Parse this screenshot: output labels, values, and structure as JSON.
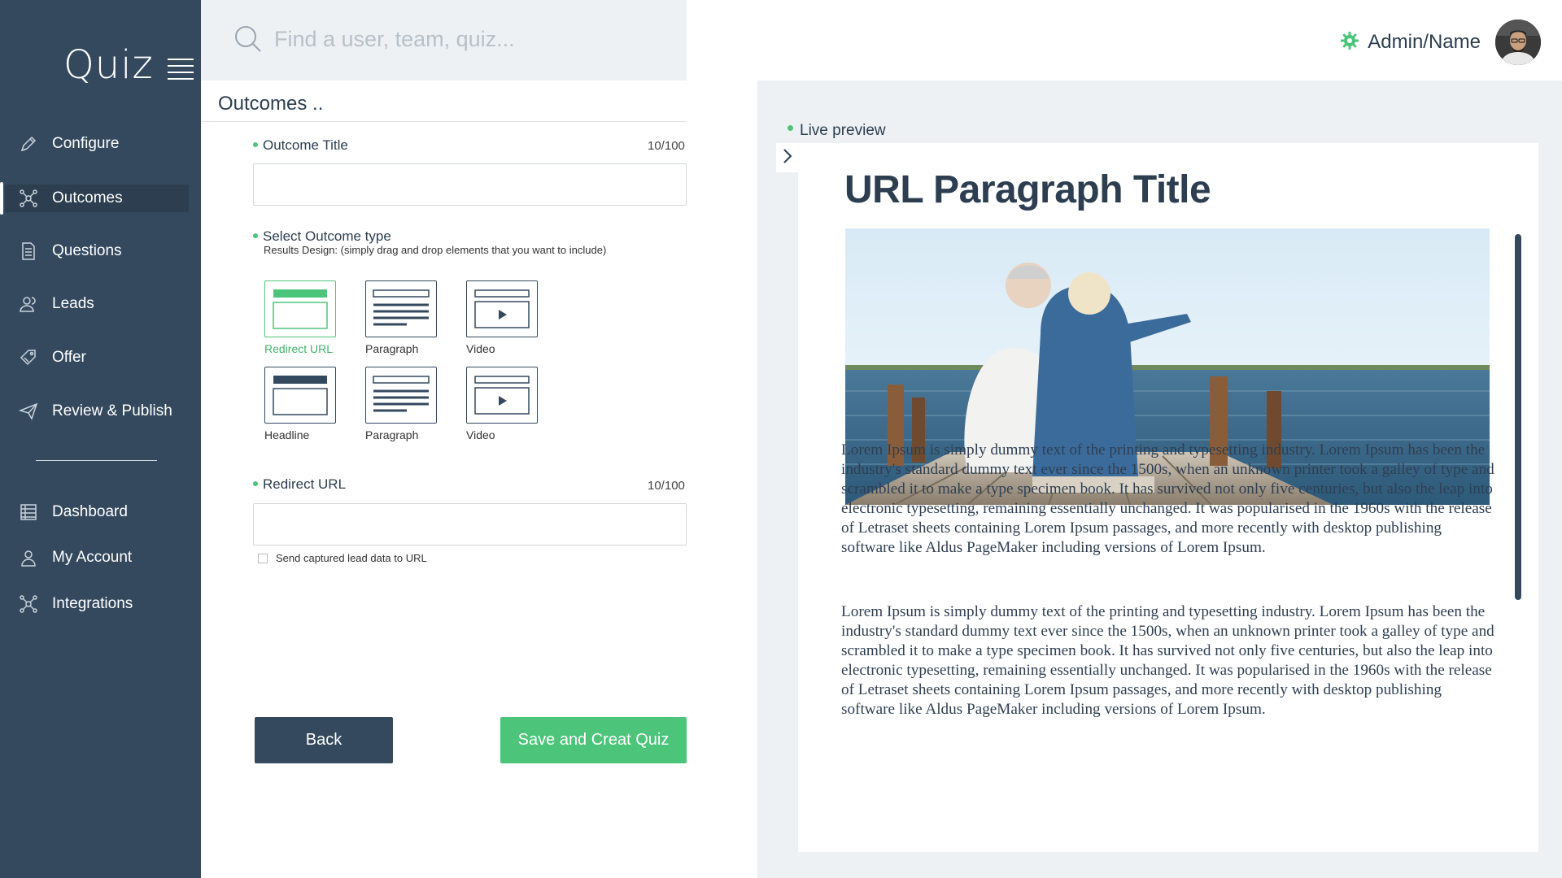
{
  "app": {
    "logo": "Quiz"
  },
  "search": {
    "placeholder": "Find a user, team, quiz..."
  },
  "header": {
    "admin_name": "Admin/Name"
  },
  "sidebar": {
    "items": [
      {
        "label": "Configure",
        "icon": "pencil-icon"
      },
      {
        "label": "Outcomes",
        "icon": "network-icon",
        "active": true
      },
      {
        "label": "Questions",
        "icon": "document-icon"
      },
      {
        "label": "Leads",
        "icon": "users-icon"
      },
      {
        "label": "Offer",
        "icon": "tag-icon"
      },
      {
        "label": "Review & Publish",
        "icon": "paper-plane-icon"
      }
    ],
    "secondary": [
      {
        "label": "Dashboard",
        "icon": "list-icon"
      },
      {
        "label": "My Account",
        "icon": "user-icon"
      },
      {
        "label": "Integrations",
        "icon": "network-icon"
      }
    ]
  },
  "panel": {
    "title": "Outcomes ..",
    "outcome_title": {
      "label": "Outcome Title",
      "counter": "10/100",
      "value": ""
    },
    "outcome_type": {
      "label": "Select Outcome type",
      "note": "Results Design: (simply drag and drop elements that you want to include)",
      "options": [
        {
          "label": "Redirect URL",
          "selected": true
        },
        {
          "label": "Paragraph"
        },
        {
          "label": "Video"
        },
        {
          "label": "Headline"
        },
        {
          "label": "Paragraph"
        },
        {
          "label": "Video"
        }
      ]
    },
    "redirect_url": {
      "label": "Redirect URL",
      "counter": "10/100",
      "value": ""
    },
    "send_lead": {
      "label": "Send captured lead data to URL",
      "checked": false
    },
    "back_label": "Back",
    "save_label": "Save and Creat Quiz"
  },
  "preview": {
    "label": "Live preview",
    "title": "URL Paragraph Title",
    "paragraphs": [
      "Lorem Ipsum is simply dummy text of the printing and typesetting industry. Lorem Ipsum has been the industry's standard dummy text ever since the 1500s, when an unknown printer took a galley of type and scrambled it to make a type specimen book. It has survived not only five centuries, but also the leap into electronic typesetting, remaining essentially unchanged. It was popularised in the 1960s with the release of Letraset sheets containing Lorem Ipsum passages, and more recently with desktop publishing software like Aldus PageMaker including versions of Lorem Ipsum.",
      "Lorem Ipsum is simply dummy text of the printing and typesetting industry. Lorem Ipsum has been the industry's standard dummy text ever since the 1500s, when an unknown printer took a galley of type and scrambled it to make a type specimen book. It has survived not only five centuries, but also the leap into electronic typesetting, remaining essentially unchanged. It was popularised in the 1960s with the release of Letraset sheets containing Lorem Ipsum passages, and more recently with desktop publishing software like Aldus PageMaker including versions of Lorem Ipsum."
    ]
  },
  "colors": {
    "sidebar": "#34495e",
    "accent_green": "#4cc57a",
    "dark_text": "#2c3e50",
    "preview_bg": "#eef1f4"
  }
}
